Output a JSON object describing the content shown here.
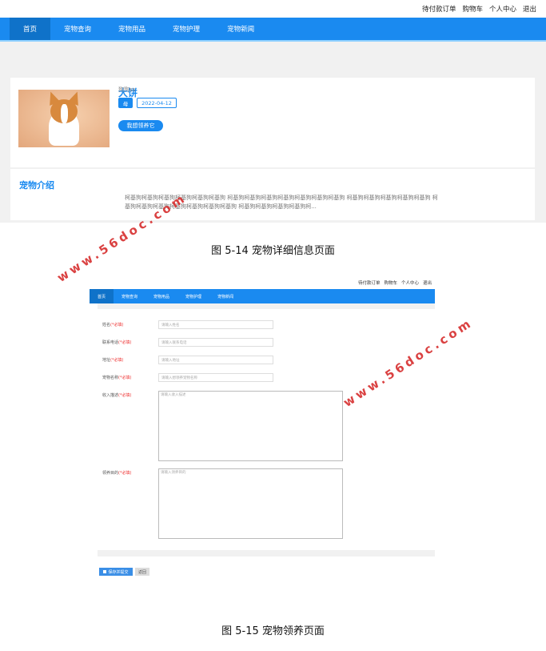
{
  "figure1": {
    "topbar": [
      "待付款订单",
      "购物车",
      "个人中心",
      "退出"
    ],
    "nav": [
      "首页",
      "宠物查询",
      "宠物用品",
      "宠物护理",
      "宠物新闻"
    ],
    "pet": {
      "name": "大饼",
      "breed": "狗狗ss",
      "sex": "母",
      "date": "2022-04-12",
      "adopt_button": "我想领养它"
    },
    "intro": {
      "title": "宠物介绍",
      "text": "柯基狗柯基狗柯基狗柯基狗柯基狗柯基狗 柯基狗柯基狗柯基狗柯基狗柯基狗柯基狗柯基狗 柯基狗柯基狗柯基狗柯基狗柯基狗 柯基狗柯基狗柯基狗柯基狗柯基狗柯基狗柯基狗 柯基狗柯基狗柯基狗柯基狗柯..."
    },
    "caption": "图 5-14  宠物详细信息页面"
  },
  "figure2": {
    "topbar": [
      "待付款订单",
      "购物车",
      "个人中心",
      "退出"
    ],
    "nav": [
      "首页",
      "宠物查询",
      "宠物用品",
      "宠物护理",
      "宠物新闻"
    ],
    "required": "(*必填)",
    "fields": [
      {
        "label": "姓名",
        "placeholder": "请输入姓名"
      },
      {
        "label": "联系电话",
        "placeholder": "请输入联系电话"
      },
      {
        "label": "地址",
        "placeholder": "请输入地址"
      },
      {
        "label": "宠物名称",
        "placeholder": "请输入想领养宠物名称"
      },
      {
        "label": "收入描述",
        "placeholder": "请输入收入描述"
      },
      {
        "label": "领养目的",
        "placeholder": "请输入领养目的"
      }
    ],
    "save_button": "保存并提交",
    "back_button": "返回",
    "caption": "图 5-15  宠物领养页面"
  },
  "watermark": "www.56doc.com"
}
